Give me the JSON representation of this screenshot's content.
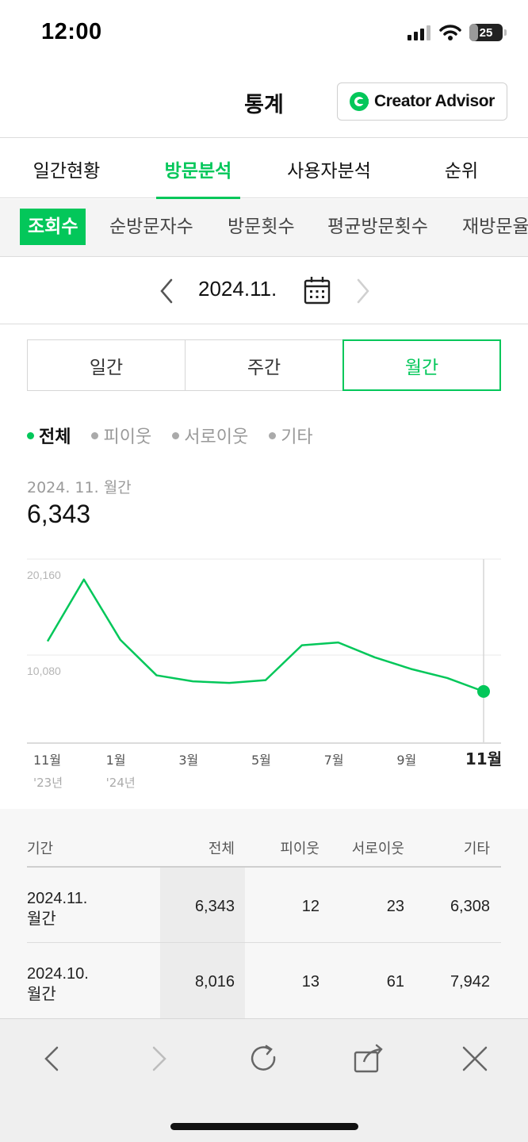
{
  "status_bar": {
    "time": "12:00",
    "battery": "25",
    "battery_level": 0.25
  },
  "header": {
    "title": "통계",
    "advisor_label": "Creator Advisor"
  },
  "main_tabs": [
    {
      "label": "일간현황",
      "active": false
    },
    {
      "label": "방문분석",
      "active": true
    },
    {
      "label": "사용자분석",
      "active": false
    },
    {
      "label": "순위",
      "active": false
    }
  ],
  "sub_tabs": [
    {
      "label": "조회수",
      "active": true
    },
    {
      "label": "순방문자수",
      "active": false
    },
    {
      "label": "방문횟수",
      "active": false
    },
    {
      "label": "평균방문횟수",
      "active": false
    },
    {
      "label": "재방문율",
      "active": false
    }
  ],
  "date_nav": {
    "label": "2024.11."
  },
  "period_options": [
    {
      "label": "일간",
      "active": false
    },
    {
      "label": "주간",
      "active": false
    },
    {
      "label": "월간",
      "active": true
    }
  ],
  "filters": [
    {
      "label": "전체",
      "active": true
    },
    {
      "label": "피이웃",
      "active": false
    },
    {
      "label": "서로이웃",
      "active": false
    },
    {
      "label": "기타",
      "active": false
    }
  ],
  "summary": {
    "period": "2024. 11. 월간",
    "value": "6,343"
  },
  "colors": {
    "accent": "#03c75a",
    "grid": "#e6e6e6",
    "text_muted": "#9a9a9a"
  },
  "chart_data": {
    "type": "line",
    "x": [
      "11월 '23년",
      "12월",
      "1월 '24년",
      "2월",
      "3월",
      "4월",
      "5월",
      "6월",
      "7월",
      "8월",
      "9월",
      "10월",
      "11월"
    ],
    "series": [
      {
        "values": [
          12600,
          20300,
          12800,
          8350,
          7600,
          7400,
          7750,
          12100,
          12450,
          10600,
          9150,
          8016,
          6343
        ]
      }
    ],
    "y_ticks": [
      "20,160",
      "10,080"
    ],
    "ylim": [
      0,
      24330
    ],
    "x_tick_labels": [
      {
        "label": "11월",
        "sub": "'23년",
        "index": 0
      },
      {
        "label": "1월",
        "sub": "'24년",
        "index": 2
      },
      {
        "label": "3월",
        "sub": "",
        "index": 4
      },
      {
        "label": "5월",
        "sub": "",
        "index": 6
      },
      {
        "label": "7월",
        "sub": "",
        "index": 8
      },
      {
        "label": "9월",
        "sub": "",
        "index": 10
      },
      {
        "label": "11월",
        "sub": "",
        "index": 12,
        "bold": true
      }
    ],
    "highlight_index": 12,
    "grid": true
  },
  "table": {
    "headers": [
      "기간",
      "전체",
      "피이웃",
      "서로이웃",
      "기타"
    ],
    "rows": [
      {
        "period_line1": "2024.11.",
        "period_line2": "월간",
        "total": "6,343",
        "neighbor": "12",
        "mutual": "23",
        "other": "6,308"
      },
      {
        "period_line1": "2024.10.",
        "period_line2": "월간",
        "total": "8,016",
        "neighbor": "13",
        "mutual": "61",
        "other": "7,942"
      }
    ]
  }
}
